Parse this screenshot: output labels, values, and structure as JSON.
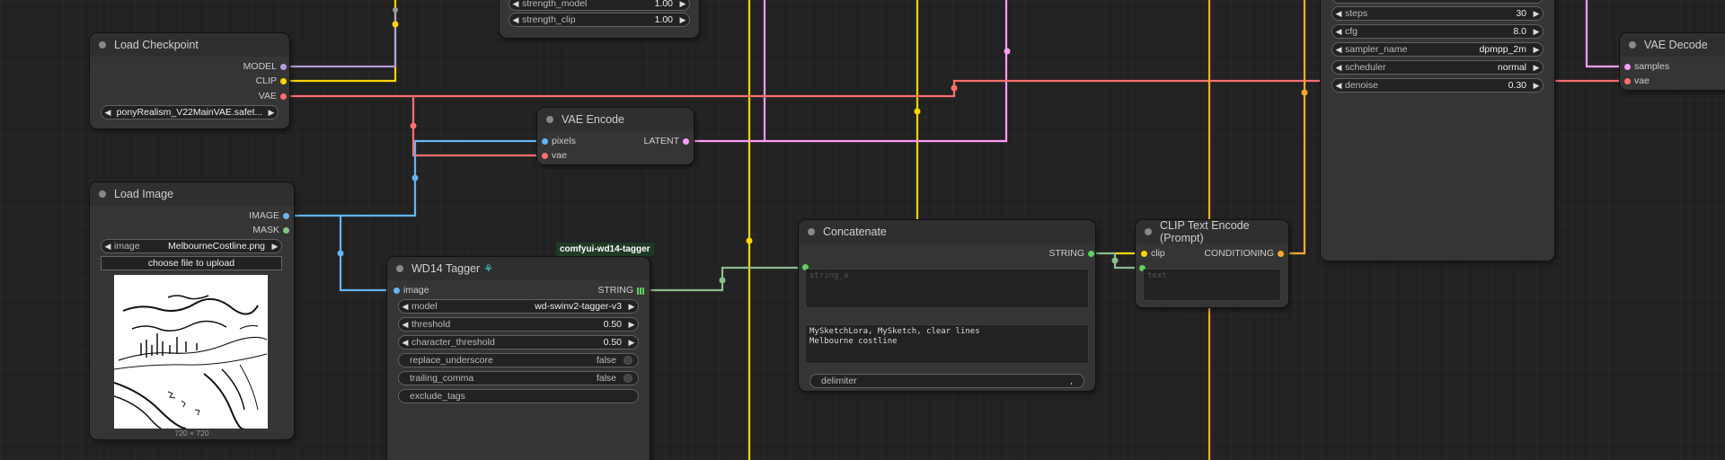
{
  "nodes": {
    "load_checkpoint": {
      "title": "Load Checkpoint",
      "outputs": [
        "MODEL",
        "CLIP",
        "VAE"
      ],
      "ckpt_name": "ponyRealism_V22MainVAE.safet..."
    },
    "load_image": {
      "title": "Load Image",
      "outputs": [
        "IMAGE",
        "MASK"
      ],
      "image_label": "image",
      "image_value": "MelbourneCostline.png",
      "upload_button": "choose file to upload",
      "dims": "720 × 720"
    },
    "lora_partial": {
      "strength_model_label": "strength_model",
      "strength_model_value": "1.00",
      "strength_clip_label": "strength_clip",
      "strength_clip_value": "1.00"
    },
    "vae_encode": {
      "title": "VAE Encode",
      "inputs": [
        "pixels",
        "vae"
      ],
      "output": "LATENT"
    },
    "wd14": {
      "badge": "comfyui-wd14-tagger",
      "title": "WD14 Tagger",
      "input": "image",
      "output": "STRING",
      "model_label": "model",
      "model_value": "wd-swinv2-tagger-v3",
      "threshold_label": "threshold",
      "threshold_value": "0.50",
      "char_threshold_label": "character_threshold",
      "char_threshold_value": "0.50",
      "replace_underscore_label": "replace_underscore",
      "replace_underscore_value": "false",
      "trailing_comma_label": "trailing_comma",
      "trailing_comma_value": "false",
      "exclude_tags_label": "exclude_tags"
    },
    "concatenate": {
      "title": "Concatenate",
      "output": "STRING",
      "string_a_placeholder": "string_a",
      "string_b_text": "MySketchLora, MySketch, clear lines\nMelbourne costline",
      "delimiter_label": "delimiter",
      "delimiter_value": ","
    },
    "clip_text_encode": {
      "title": "CLIP Text Encode (Prompt)",
      "input": "clip",
      "output": "CONDITIONING",
      "text_placeholder": "text"
    },
    "ksampler_partial": {
      "steps_label": "steps",
      "steps_value": "30",
      "cfg_label": "cfg",
      "cfg_value": "8.0",
      "sampler_label": "sampler_name",
      "sampler_value": "dpmpp_2m",
      "scheduler_label": "scheduler",
      "scheduler_value": "normal",
      "denoise_label": "denoise",
      "denoise_value": "0.30"
    },
    "vae_decode": {
      "title": "VAE Decode",
      "inputs": [
        "samples",
        "vae"
      ]
    }
  },
  "colors": {
    "model": "#b39ddb",
    "clip": "#ffd500",
    "vae": "#ff6e6e",
    "image": "#64b5f6",
    "latent": "#ff9cf9",
    "string": "#8fbc8f",
    "mask": "#81c784",
    "conditioning": "#ffa931"
  }
}
